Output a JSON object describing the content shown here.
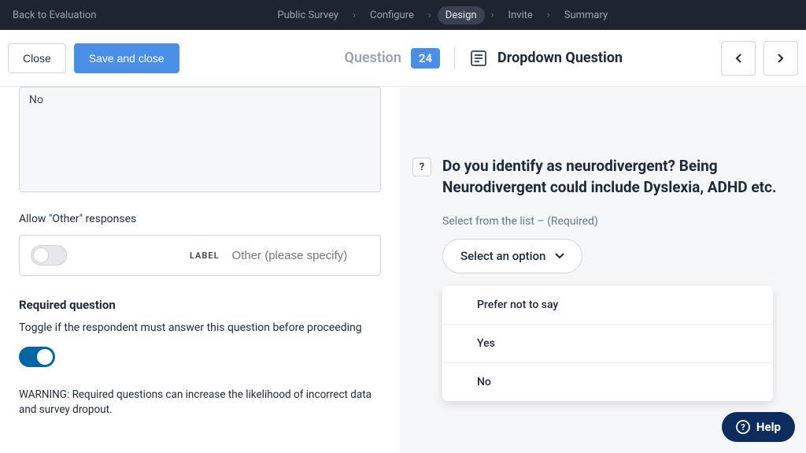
{
  "topbar": {
    "back": "Back to Evaluation",
    "crumbs": [
      "Public Survey",
      "Configure",
      "Design",
      "Invite",
      "Summary"
    ],
    "active_index": 2
  },
  "header": {
    "close": "Close",
    "save": "Save and close",
    "question_label": "Question",
    "question_number": "24",
    "question_type": "Dropdown Question"
  },
  "editor": {
    "options_textarea": "No",
    "allow_other_label": "Allow \"Other\" responses",
    "label_tag": "LABEL",
    "other_placeholder": "Other (please specify)",
    "required_heading": "Required question",
    "required_desc": "Toggle if the respondent must answer this question before proceeding",
    "warning": "WARNING: Required questions can increase the likelihood of incorrect data and survey dropout."
  },
  "preview": {
    "question_text": "Do you identify as neurodivergent? Being Neurodivergent could include Dyslexia, ADHD etc.",
    "sub_label": "Select from the list – (Required)",
    "dropdown_placeholder": "Select an option",
    "options": [
      "Prefer not to say",
      "Yes",
      "No"
    ]
  },
  "help": "Help"
}
